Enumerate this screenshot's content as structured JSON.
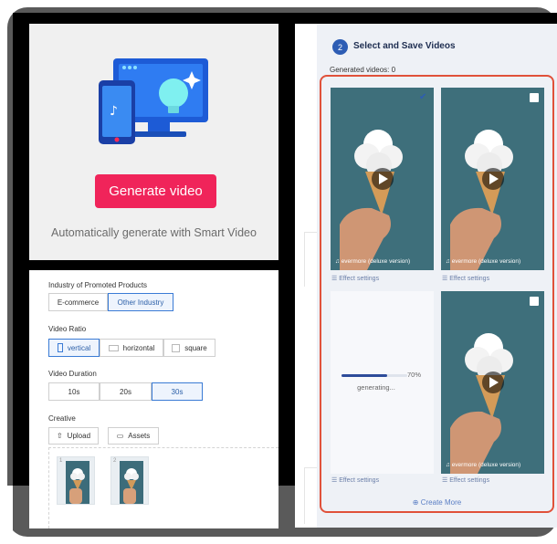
{
  "generate": {
    "button": "Generate video",
    "caption": "Automatically generate with Smart Video"
  },
  "form": {
    "industry_label": "Industry of Promoted Products",
    "industry_options": [
      "E-commerce",
      "Other Industry"
    ],
    "industry_selected": "Other Industry",
    "ratio_label": "Video Ratio",
    "ratio_options": [
      "vertical",
      "horizontal",
      "square"
    ],
    "ratio_selected": "vertical",
    "duration_label": "Video Duration",
    "duration_options": [
      "10s",
      "20s",
      "30s"
    ],
    "duration_selected": "30s",
    "creative_label": "Creative",
    "upload": "Upload",
    "assets": "Assets",
    "thumbs": [
      "1",
      "2"
    ]
  },
  "select": {
    "step": "2",
    "title": "Select and Save Videos",
    "generated": "Generated videos: 0",
    "song": "evermore (deluxe version)",
    "effect": "Effect settings",
    "progress_pct": "70%",
    "progress_value": 0.7,
    "generating": "generating...",
    "create_more": "Create More"
  },
  "icons": {
    "play": "play-icon",
    "music": "music-note-icon",
    "settings": "sliders-icon",
    "upload": "upload-icon",
    "folder": "folder-icon",
    "plus": "plus-circle-icon",
    "check": "check-icon"
  },
  "colors": {
    "primary_button": "#f0245a",
    "accent_blue": "#2d5db4",
    "highlight_border": "#e0513a"
  }
}
